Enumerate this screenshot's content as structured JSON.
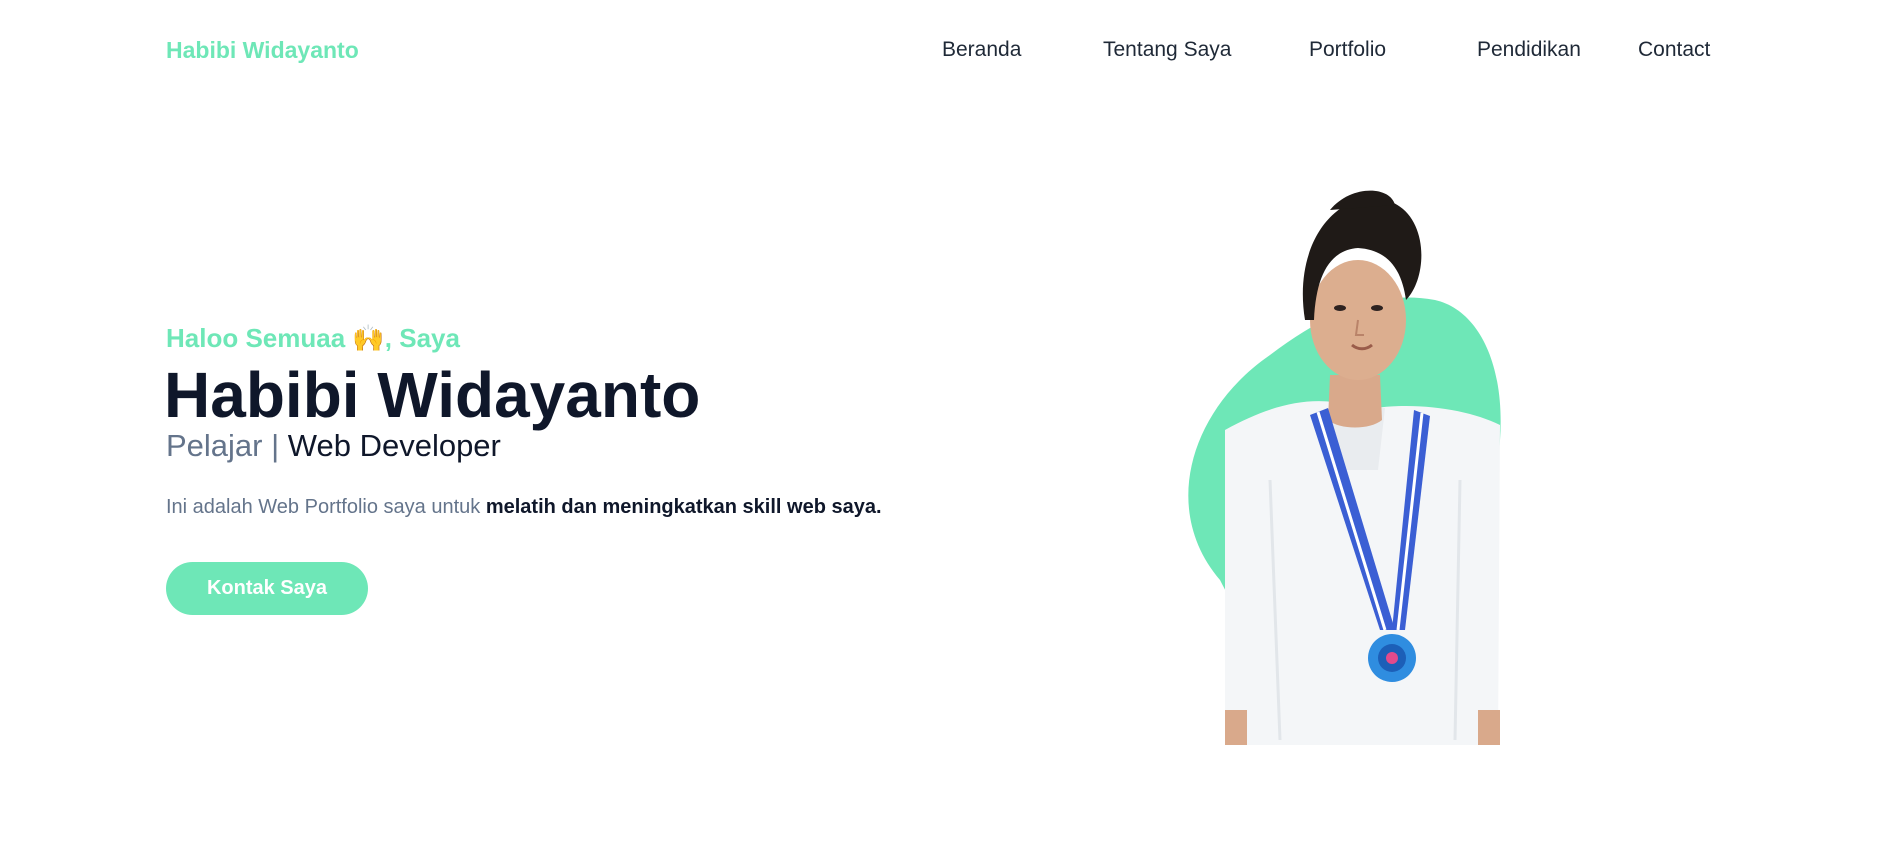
{
  "navbar": {
    "brand": "Habibi Widayanto",
    "links": [
      {
        "label": "Beranda"
      },
      {
        "label": "Tentang Saya"
      },
      {
        "label": "Portfolio"
      },
      {
        "label": "Pendidikan"
      },
      {
        "label": "Contact"
      }
    ]
  },
  "hero": {
    "greeting_text": "Haloo Semuaa ",
    "greeting_emoji": "🙌",
    "greeting_suffix": ", Saya",
    "name": "Habibi Widayanto",
    "role_primary": "Pelajar | ",
    "role_secondary": "Web Developer",
    "description_plain": "Ini adalah Web Portfolio saya untuk ",
    "description_bold": "melatih dan meningkatkan skill web saya.",
    "cta_label": "Kontak Saya"
  },
  "colors": {
    "accent": "#6ee7b7",
    "heading": "#0f172a",
    "muted": "#64748b"
  }
}
